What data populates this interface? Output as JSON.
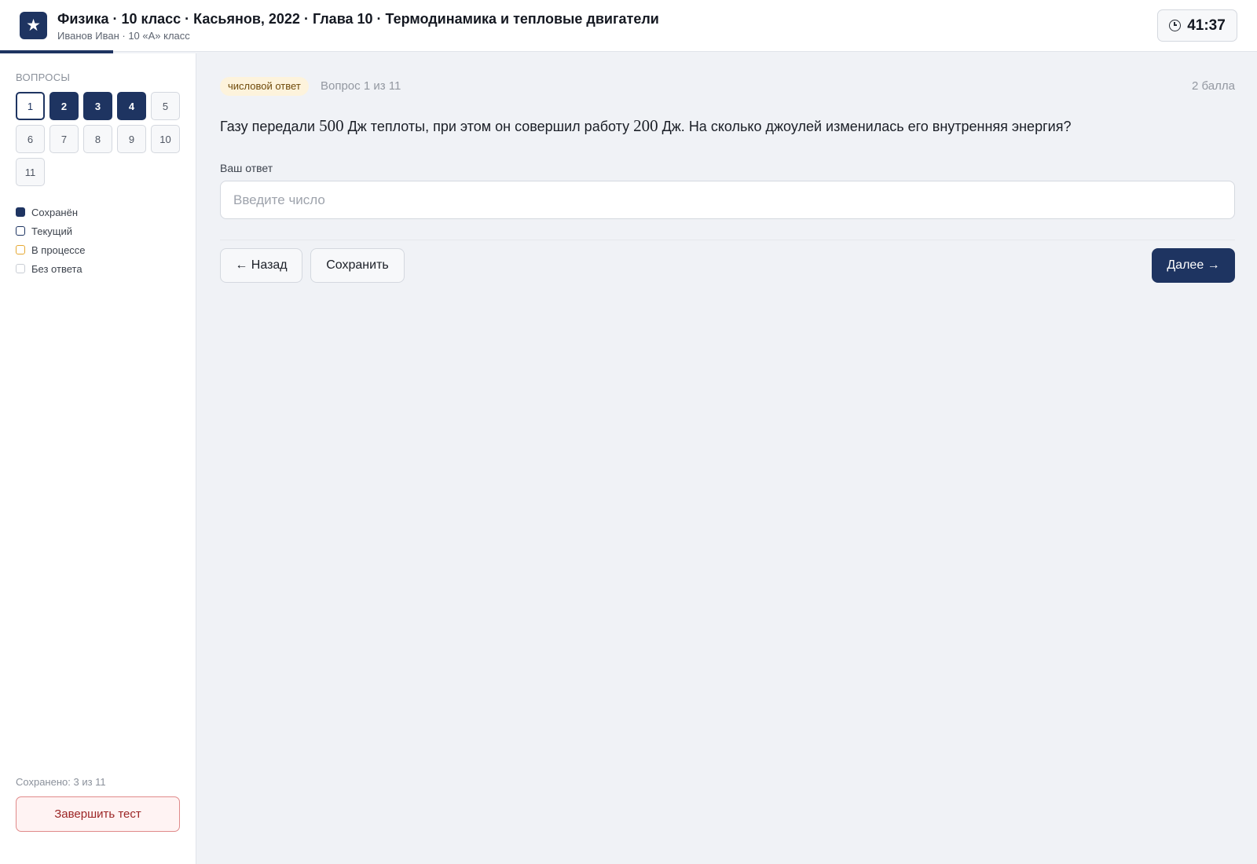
{
  "header": {
    "logo_glyph": "★",
    "title": "Физика · 10 класс · Касьянов, 2022 · Глава 10 · Термодинамика и тепловые двигатели",
    "subtitle": "Иванов Иван · 10 «А» класс",
    "timer": "41:37",
    "timer_icon": "clock-icon"
  },
  "progress": {
    "fraction": 0.09,
    "color": "#1e3461"
  },
  "sidebar": {
    "heading": "ВОПРОСЫ",
    "questions": [
      {
        "label": "1",
        "state": "current"
      },
      {
        "label": "2",
        "state": "saved"
      },
      {
        "label": "3",
        "state": "saved"
      },
      {
        "label": "4",
        "state": "saved"
      },
      {
        "label": "5",
        "state": "none"
      },
      {
        "label": "6",
        "state": "none"
      },
      {
        "label": "7",
        "state": "none"
      },
      {
        "label": "8",
        "state": "none"
      },
      {
        "label": "9",
        "state": "none"
      },
      {
        "label": "10",
        "state": "none"
      },
      {
        "label": "11",
        "state": "none"
      }
    ],
    "legend": [
      {
        "label": "Сохранён",
        "kind": "saved"
      },
      {
        "label": "Текущий",
        "kind": "current"
      },
      {
        "label": "В процессе",
        "kind": "progress-sw"
      },
      {
        "label": "Без ответа",
        "kind": "none"
      }
    ],
    "saved_count": "Сохранено: 3 из 11",
    "finish_label": "Завершить тест"
  },
  "question": {
    "type_badge": "числовой ответ",
    "number": "Вопрос 1 из 11",
    "points": "2 балла",
    "text_1": "Газу передали ",
    "value_1": "500",
    "text_2": " Дж теплоты, при этом он совершил работу ",
    "value_2": "200",
    "text_3": " Дж. На сколько джоулей изменилась его внутренняя энергия?",
    "answer_label": "Ваш ответ",
    "answer_value": "",
    "answer_placeholder": "Введите число"
  },
  "buttons": {
    "back": "← Назад",
    "save": "Сохранить",
    "next": "Далее →"
  },
  "colors": {
    "accent": "#1e3461",
    "in_progress": "#e5a832",
    "danger": "#9b2626"
  }
}
